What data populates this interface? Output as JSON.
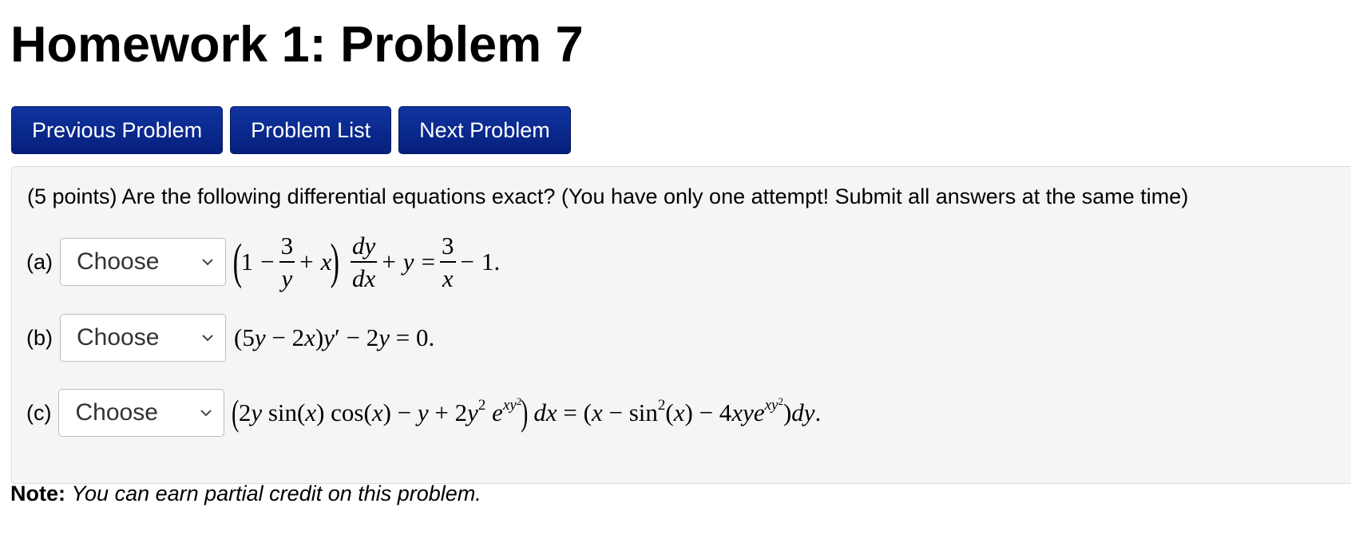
{
  "page": {
    "title": "Homework 1: Problem 7"
  },
  "nav": {
    "previous_label": "Previous Problem",
    "list_label": "Problem List",
    "next_label": "Next Problem"
  },
  "problem": {
    "prompt": "(5 points) Are the following differential equations exact? (You have only one attempt! Submit all answers at the same time)",
    "parts": [
      {
        "label": "(a)",
        "select_value": "Choose",
        "equation": "(1 − 3/y + x) dy/dx + y = 3/x − 1."
      },
      {
        "label": "(b)",
        "select_value": "Choose",
        "equation": "(5y − 2x)y′ − 2y = 0."
      },
      {
        "label": "(c)",
        "select_value": "Choose",
        "equation": "(2y sin(x) cos(x) − y + 2y² e^(xy²)) dx = (x − sin²(x) − 4xye^(xy²))dy."
      }
    ]
  },
  "note": {
    "label": "Note:",
    "text": "You can earn partial credit on this problem."
  },
  "colors": {
    "nav_button_bg": "#0b2a8e",
    "problem_box_bg": "#f5f5f5"
  }
}
